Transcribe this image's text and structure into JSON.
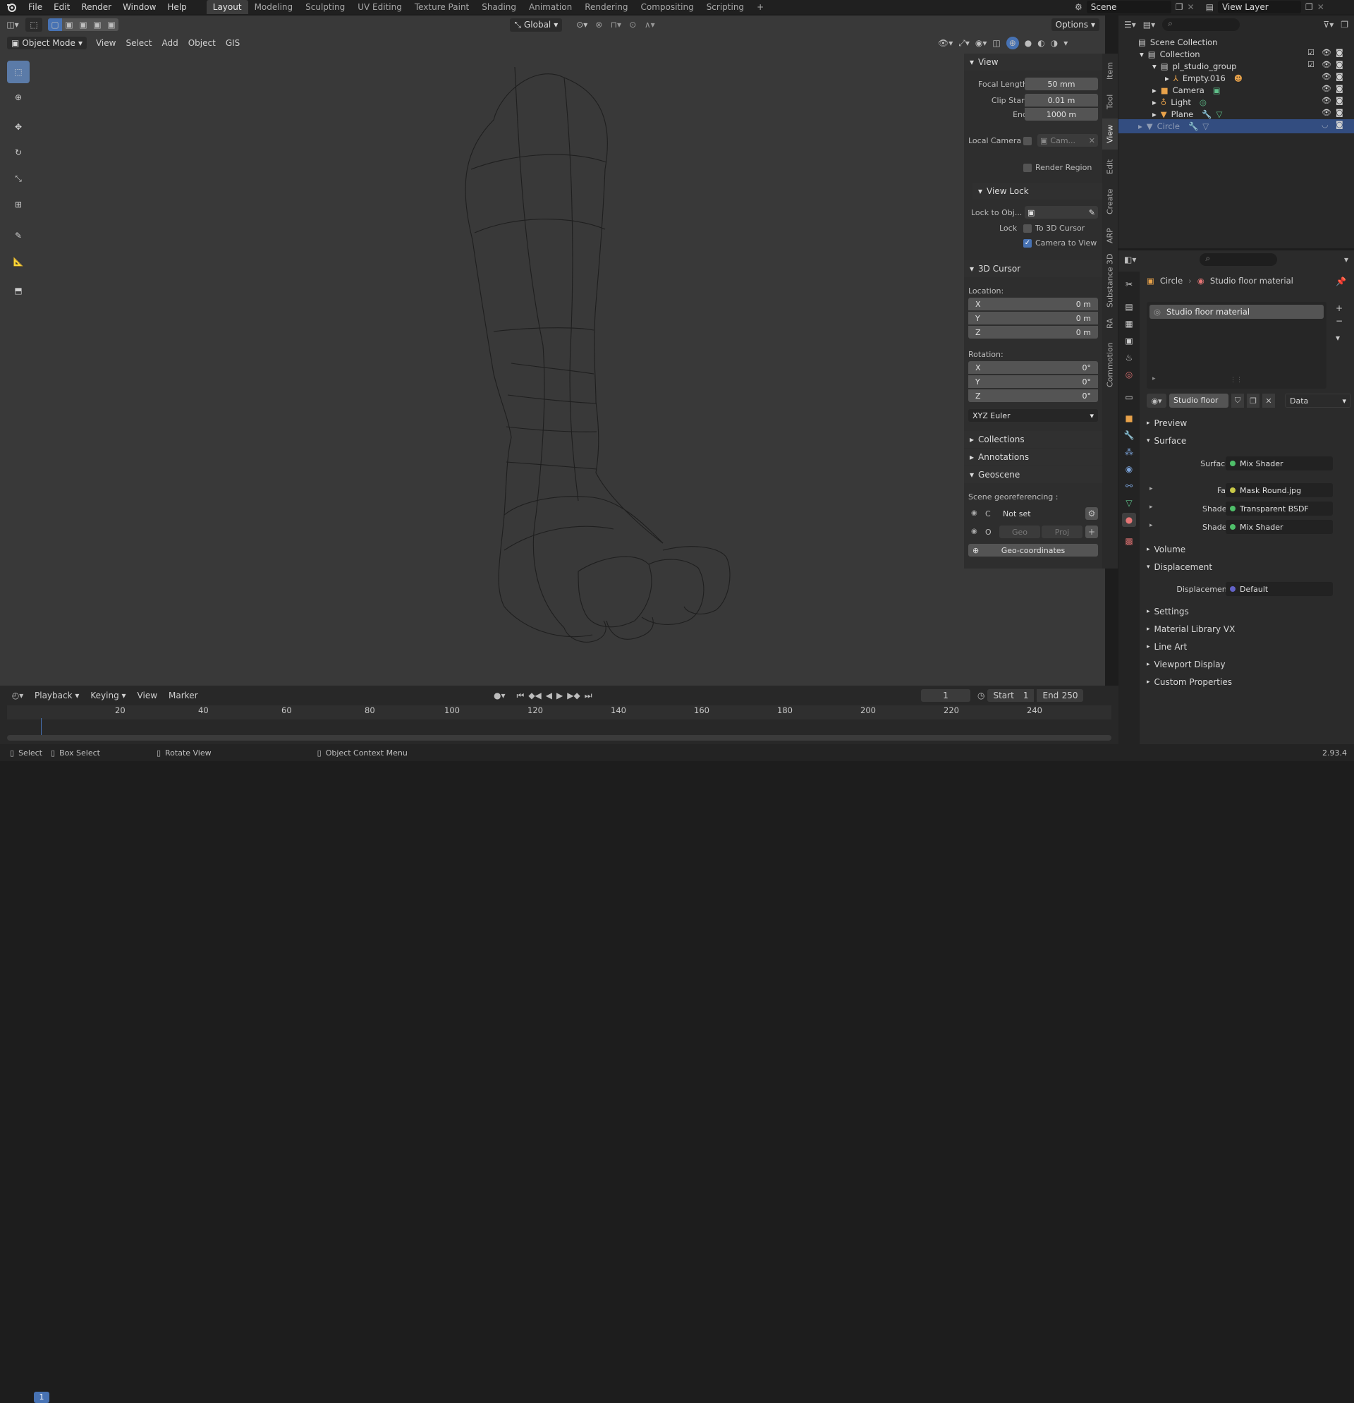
{
  "topbar": {
    "menus": [
      "File",
      "Edit",
      "Render",
      "Window",
      "Help"
    ],
    "workspaces": [
      "Layout",
      "Modeling",
      "Sculpting",
      "UV Editing",
      "Texture Paint",
      "Shading",
      "Animation",
      "Rendering",
      "Compositing",
      "Scripting"
    ],
    "active_workspace": "Layout",
    "add_tab": "+",
    "scene_name": "Scene",
    "view_layer": "View Layer"
  },
  "viewport_header": {
    "mode": "Object Mode",
    "menus": [
      "View",
      "Select",
      "Add",
      "Object",
      "GIS"
    ],
    "orientation": "Global",
    "options": "Options"
  },
  "npanel": {
    "view": {
      "title": "View",
      "focal_length_label": "Focal Length",
      "focal_length": "50 mm",
      "clip_start_label": "Clip Start",
      "clip_start": "0.01 m",
      "end_label": "End",
      "end": "1000 m",
      "local_camera_label": "Local Camera",
      "local_camera_value": "Cam...",
      "render_region": "Render Region"
    },
    "view_lock": {
      "title": "View Lock",
      "lock_to_obj_label": "Lock to Obj...",
      "lock_label": "Lock",
      "to_3d_cursor": "To 3D Cursor",
      "camera_to_view": "Camera to View"
    },
    "cursor": {
      "title": "3D Cursor",
      "location_label": "Location:",
      "loc": [
        {
          "axis": "X",
          "value": "0 m"
        },
        {
          "axis": "Y",
          "value": "0 m"
        },
        {
          "axis": "Z",
          "value": "0 m"
        }
      ],
      "rotation_label": "Rotation:",
      "rot": [
        {
          "axis": "X",
          "value": "0°"
        },
        {
          "axis": "Y",
          "value": "0°"
        },
        {
          "axis": "Z",
          "value": "0°"
        }
      ],
      "rotation_mode": "XYZ Euler"
    },
    "collections": "Collections",
    "annotations": "Annotations",
    "geoscene": {
      "title": "Geoscene",
      "georef_label": "Scene georeferencing :",
      "c_label": "C",
      "c_value": "Not set",
      "o_label": "O",
      "geo_btn": "Geo",
      "proj_btn": "Proj",
      "geo_coords": "Geo-coordinates"
    }
  },
  "vtabs": [
    "Item",
    "Tool",
    "View",
    "Edit",
    "Create",
    "ARP",
    "Substance 3D",
    "RA",
    "Commotion"
  ],
  "active_vtab": "View",
  "outliner": {
    "scene_collection": "Scene Collection",
    "items": [
      {
        "label": "Collection"
      },
      {
        "label": "pl_studio_group"
      },
      {
        "label": "Empty.016"
      },
      {
        "label": "Camera"
      },
      {
        "label": "Light"
      },
      {
        "label": "Plane"
      },
      {
        "label": "Circle"
      }
    ]
  },
  "properties": {
    "object_name": "Circle",
    "material_name": "Studio floor material",
    "slot_label": "Studio floor material",
    "material_short": "Studio floor m...",
    "link_mode": "Data",
    "sections": {
      "preview": "Preview",
      "surface": "Surface",
      "volume": "Volume",
      "displacement": "Displacement",
      "settings": "Settings",
      "material_library": "Material Library VX",
      "line_art": "Line Art",
      "viewport_display": "Viewport Display",
      "custom_properties": "Custom Properties"
    },
    "surface_rows": [
      {
        "label": "Surface",
        "value": "Mix Shader",
        "color": "#4fbf6a"
      },
      {
        "label": "Fac",
        "value": "Mask Round.jpg",
        "color": "#c8c848"
      },
      {
        "label": "Shader",
        "value": "Transparent BSDF",
        "color": "#4fbf6a"
      },
      {
        "label": "Shader",
        "value": "Mix Shader",
        "color": "#4fbf6a"
      }
    ],
    "displacement_row": {
      "label": "Displacement",
      "value": "Default",
      "color": "#6363c7"
    }
  },
  "timeline": {
    "menus": [
      "Playback",
      "Keying",
      "View",
      "Marker"
    ],
    "current_frame": "1",
    "start_label": "Start",
    "start": "1",
    "end_label": "End",
    "end": "250",
    "ticks": [
      "20",
      "40",
      "60",
      "80",
      "100",
      "120",
      "140",
      "160",
      "180",
      "200",
      "220",
      "240"
    ],
    "frame_marker": "1"
  },
  "status": {
    "select": "Select",
    "box_select": "Box Select",
    "rotate_view": "Rotate View",
    "context_menu": "Object Context Menu",
    "version": "2.93.4"
  },
  "colors": {
    "accent": "#4772b3",
    "selection": "#334d80",
    "active_tool": "#5b7ba8",
    "viewport_bg": "#393939"
  }
}
